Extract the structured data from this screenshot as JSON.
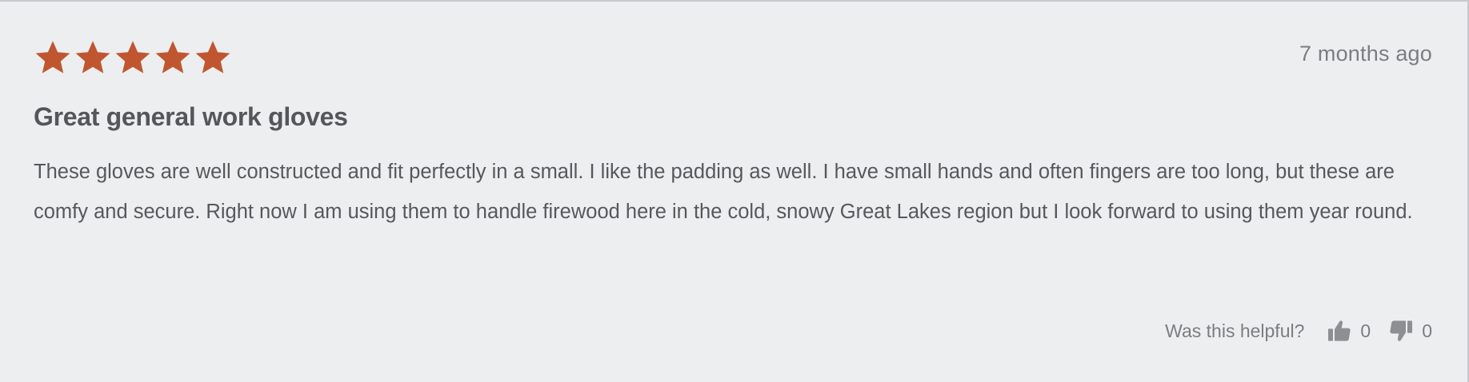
{
  "review": {
    "rating": 5,
    "rating_max": 5,
    "star_color": "#c0562f",
    "time_ago": "7 months ago",
    "title": "Great general work gloves",
    "body": "These gloves are well constructed and fit perfectly in a small. I like the padding as well. I have small hands and often fingers are too long, but these are comfy and secure. Right now I am using them to handle firewood here in the cold, snowy Great Lakes region but I look forward to using them year round."
  },
  "helpful": {
    "label": "Was this helpful?",
    "up_count": "0",
    "down_count": "0",
    "up_icon": "thumbs-up-icon",
    "down_icon": "thumbs-down-icon"
  }
}
